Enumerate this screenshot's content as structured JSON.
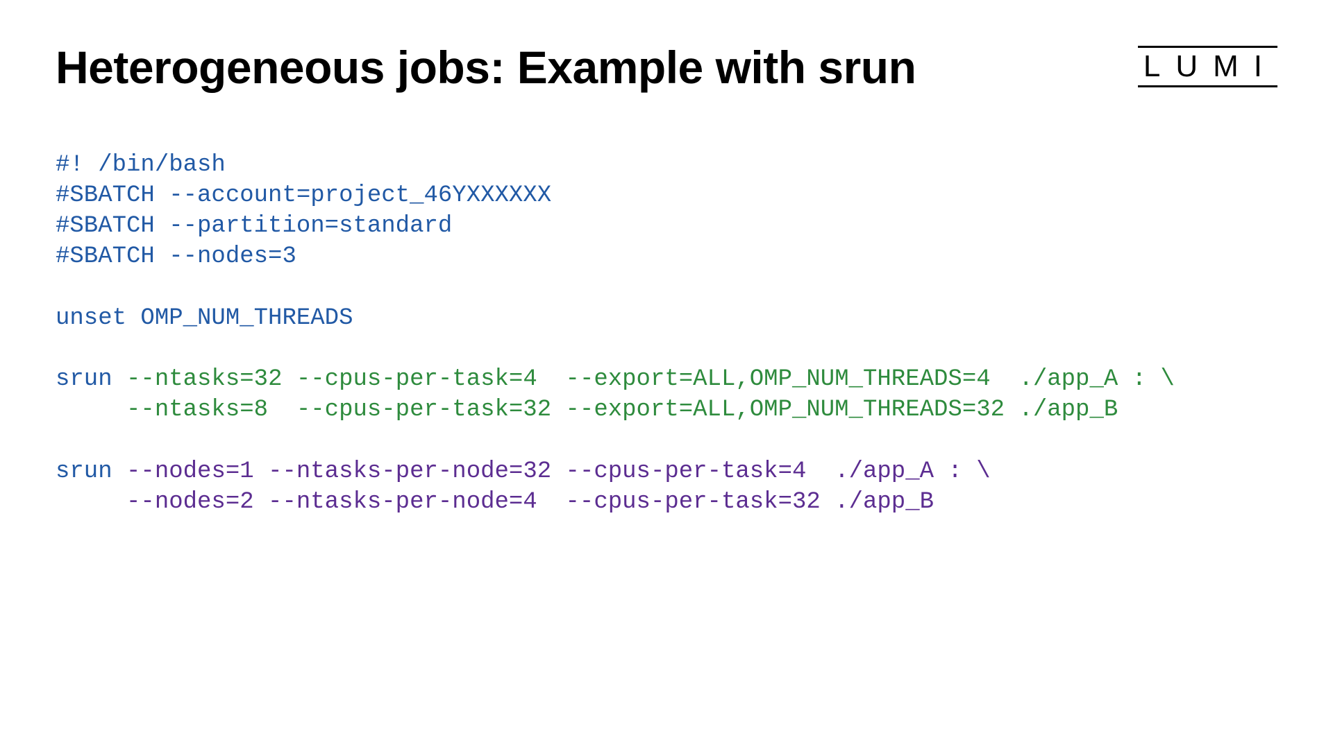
{
  "title": "Heterogeneous jobs: Example with srun",
  "logo": "LUMI",
  "colors": {
    "blue": "#2159a5",
    "green": "#2e8b3d",
    "purple": "#5c2d91"
  },
  "code": {
    "shebang": "#! /bin/bash",
    "sbatch_account": "#SBATCH --account=project_46YXXXXXX",
    "sbatch_partition": "#SBATCH --partition=standard",
    "sbatch_nodes": "#SBATCH --nodes=3",
    "unset": "unset OMP_NUM_THREADS",
    "srun1_cmd": "srun ",
    "srun1_argsA": "--ntasks=32 --cpus-per-task=4  --export=ALL,OMP_NUM_THREADS=4  ./app_A : \\",
    "srun1_argsB": "     --ntasks=8  --cpus-per-task=32 --export=ALL,OMP_NUM_THREADS=32 ./app_B",
    "srun2_cmd": "srun ",
    "srun2_argsA": "--nodes=1 --ntasks-per-node=32 --cpus-per-task=4  ./app_A : \\",
    "srun2_argsB": "     --nodes=2 --ntasks-per-node=4  --cpus-per-task=32 ./app_B"
  }
}
